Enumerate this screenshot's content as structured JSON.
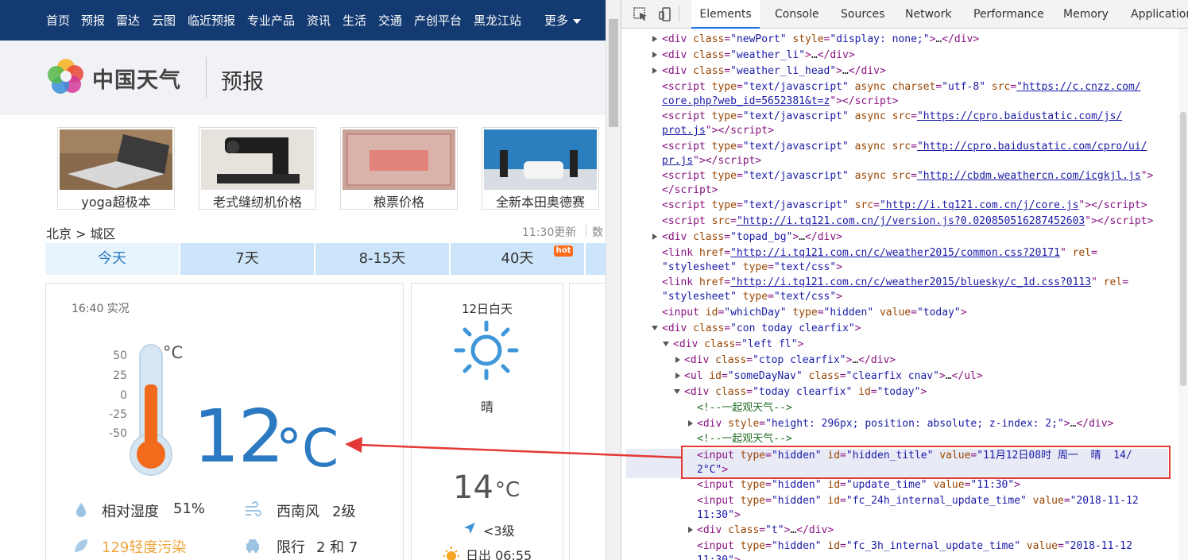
{
  "nav": {
    "items": [
      "首页",
      "预报",
      "雷达",
      "云图",
      "临近预报",
      "专业产品",
      "资讯",
      "生活",
      "交通",
      "产创平台",
      "黑龙江站"
    ],
    "more": "更多"
  },
  "header": {
    "brand": "中国天气",
    "section": "预报"
  },
  "ads": [
    {
      "caption": "yoga超极本"
    },
    {
      "caption": "老式缝纫机价格"
    },
    {
      "caption": "粮票价格"
    },
    {
      "caption": "全新本田奥德赛"
    }
  ],
  "breadcrumb": "北京 > 城区",
  "update": {
    "text": "11:30更新",
    "more": "数"
  },
  "tabs": [
    "今天",
    "7天",
    "8-15天",
    "40天"
  ],
  "hot_badge": "hot",
  "current": {
    "obs_time": "16:40 实况",
    "scale": [
      "50",
      "25",
      "0",
      "-25",
      "-50"
    ],
    "thermo_unit": "°C",
    "temp": "12",
    "unit": "°C",
    "humidity_label": "相对湿度",
    "humidity_value": "51%",
    "wind_label": "西南风",
    "wind_value": "2级",
    "aqi_label": "129轻度污染",
    "limit_label": "限行",
    "limit_value": "2 和 7",
    "aqi_color": "#f0a53e"
  },
  "forecast": {
    "title": "12日白天",
    "desc": "晴",
    "temp": "14",
    "unit": "°C",
    "wind": "<3级",
    "sunrise": "日出 06:55"
  },
  "devtools": {
    "tabs": [
      "Elements",
      "Console",
      "Sources",
      "Network",
      "Performance",
      "Memory",
      "Application"
    ],
    "lines": [
      {
        "t": "div class=\"newPort\" style=\"display: none;\">…</div>"
      },
      {
        "t": "div class=\"weather_li\">…</div>"
      },
      {
        "t": "div class=\"weather_li_head\">…</div>"
      }
    ]
  },
  "colors": {
    "nav_bg": "#143a72",
    "temp_blue": "#2a79c1",
    "tab_bg": "#cce5fa",
    "highlight_red": "#e53935"
  }
}
